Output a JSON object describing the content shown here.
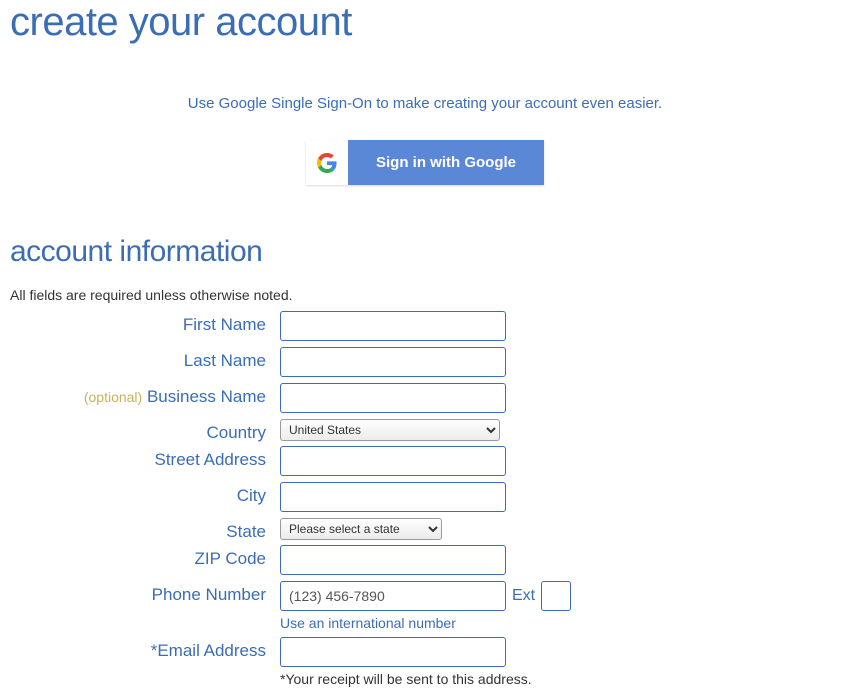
{
  "page_title": "create your account",
  "sso": {
    "text": "Use Google Single Sign-On to make creating your account even easier.",
    "button_label": "Sign in with Google"
  },
  "account": {
    "section_title": "account information",
    "required_note": "All fields are required unless otherwise noted.",
    "labels": {
      "first_name": "First Name",
      "last_name": "Last Name",
      "business_name": "Business Name",
      "optional": "(optional)",
      "country": "Country",
      "street_address": "Street Address",
      "city": "City",
      "state": "State",
      "zip": "ZIP Code",
      "phone": "Phone Number",
      "ext": "Ext",
      "email": "*Email Address"
    },
    "values": {
      "country_selected": "United States",
      "state_selected": "Please select a state",
      "phone_placeholder": "(123) 456-7890"
    },
    "hints": {
      "intl_link": "Use an international number",
      "email_note": "*Your receipt will be sent to this address."
    }
  }
}
